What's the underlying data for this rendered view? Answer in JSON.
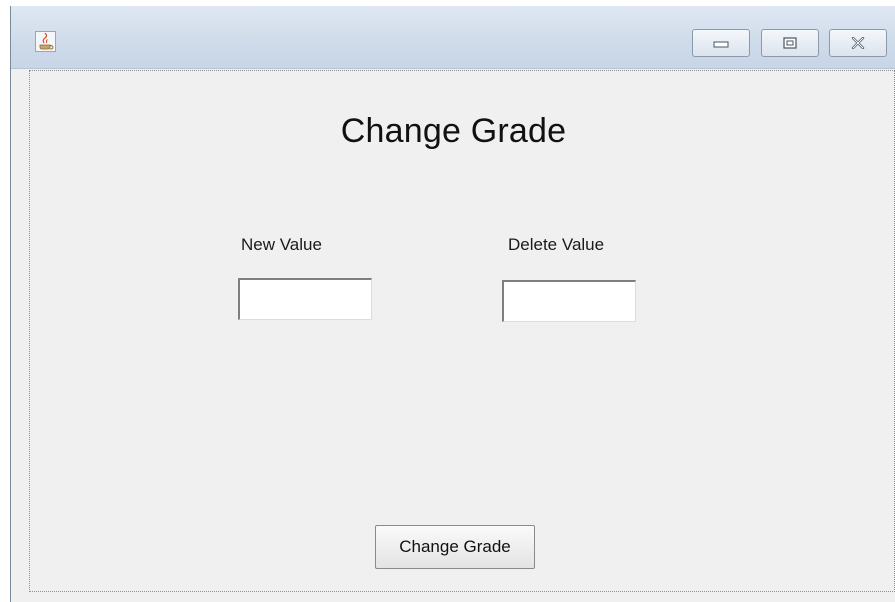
{
  "window": {
    "app_icon": "java-coffee-icon",
    "controls": [
      "minimize-icon",
      "maximize-icon",
      "close-icon"
    ]
  },
  "main": {
    "title": "Change Grade",
    "new_value": {
      "label": "New Value",
      "value": ""
    },
    "delete_value": {
      "label": "Delete Value",
      "value": ""
    },
    "submit_label": "Change Grade"
  }
}
